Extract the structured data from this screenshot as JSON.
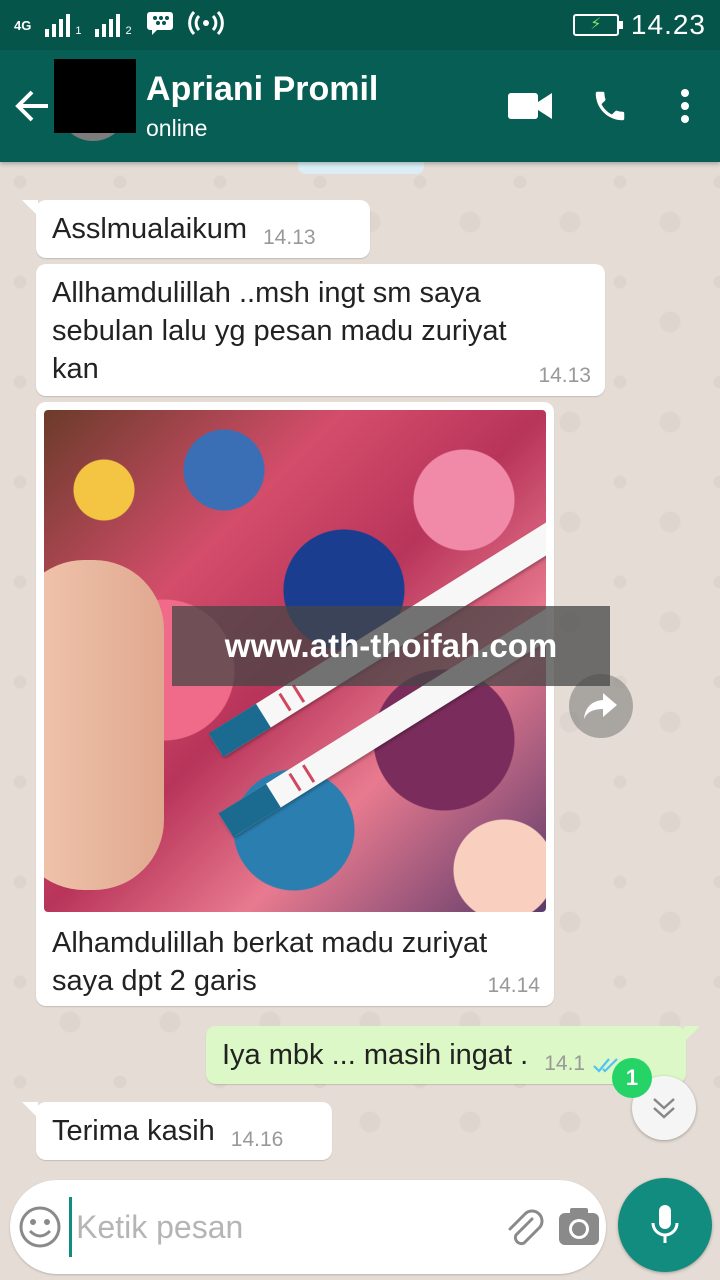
{
  "status_bar": {
    "network": "4G",
    "sim1": "1",
    "sim2": "2",
    "time": "14.23"
  },
  "header": {
    "contact_name": "Apriani Promil",
    "contact_status": "online"
  },
  "messages": [
    {
      "direction": "in",
      "text": "Asslmualaikum",
      "time": "14.13"
    },
    {
      "direction": "in",
      "text": "Allhamdulillah ..msh ingt sm saya sebulan lalu yg pesan madu zuriyat kan",
      "time": "14.13"
    },
    {
      "direction": "in",
      "type": "image",
      "caption": "Alhamdulillah berkat madu zuriyat saya dpt 2 garis",
      "time": "14.14",
      "watermark": "www.ath-thoifah.com"
    },
    {
      "direction": "out",
      "text": "Iya mbk ... masih ingat .",
      "time": "14.1",
      "status": "read"
    },
    {
      "direction": "in",
      "text": "Terima kasih",
      "time": "14.16"
    }
  ],
  "scroll_down": {
    "unread_count": "1"
  },
  "composer": {
    "placeholder": "Ketik pesan"
  },
  "colors": {
    "header": "#075e54",
    "status_bar": "#05554a",
    "outgoing_bubble": "#dcf8c6",
    "accent": "#128c7e",
    "unread_badge": "#25d366",
    "read_ticks": "#4fc3f7"
  },
  "icons": {
    "back": "arrow-left-icon",
    "video": "video-call-icon",
    "phone": "phone-icon",
    "menu": "more-vert-icon",
    "share": "forward-icon",
    "scroll": "chevron-double-down-icon",
    "emoji": "emoji-icon",
    "attach": "paperclip-icon",
    "camera": "camera-icon",
    "mic": "mic-icon"
  }
}
